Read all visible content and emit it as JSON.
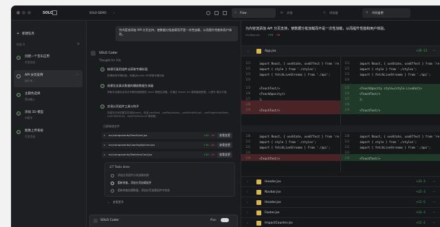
{
  "titlebar": {
    "brand": "SOLO",
    "project": "SOLO-DEMO",
    "tabs": [
      "Flow",
      "文档",
      "浏览器",
      "代码变更"
    ]
  },
  "sidebar": {
    "new_task": "新建任务",
    "section": "任务 3",
    "items": [
      {
        "title": "创建一个音乐应用",
        "sub": "开发完成"
      },
      {
        "title": "API 分页支持",
        "sub": "进行中..."
      },
      {
        "title": "主题色选择",
        "sub": "等待输入"
      },
      {
        "title": "添加 3D 模型",
        "sub": "中断中"
      },
      {
        "title": "图像上传系统",
        "sub": "开发完成"
      }
    ]
  },
  "chat": {
    "user_msg": "为内容流添加 API 分页支持，使数据分批加载而不是一次性加载，从而提升性能和用户体验。",
    "agent_name": "SOLO Coder",
    "thought": "Thought for 10s",
    "steps": [
      {
        "title": "梳理可复用组件以获取专辑封面",
        "desc": "梳理使用专辑封面，而通过fpulify API获取专辑封面"
      },
      {
        "title": "创建包含真实数据的播放数据生成器",
        "desc": "获取并创建包含真实专辑封面数据的 mock 数据生成器，并通过 Album art 更新播放数据，以提升 展示方案。"
      },
      {
        "title": "实现分页组件工具与钩子",
        "desc": "完成在已有的源文件添加mock，包括 useFeed，usePagination，useInfiniteScroll，useFragmentsState、useInfiniteList、useInfiniteCount 等函数。"
      }
    ],
    "files_header": "已经修改文件",
    "files": [
      {
        "name": "src/components/FeedCard.jsx",
        "add": "+20",
        "del": "-10",
        "btn": "查看变更"
      },
      {
        "name": "src/components/LoadingSpinner.jsx",
        "add": "+10",
        "del": "-20",
        "btn": "查看变更"
      },
      {
        "name": "src/components/SkeletonCard.jsx",
        "add": "+20",
        "del": "-10",
        "btn": "查看变更"
      }
    ],
    "todos_header": "1/7  Tasks done",
    "todos": [
      "添加分页组件分块加载机制",
      "重新修复，添加分页加载组件",
      "重新修复加载数据，添加分页加载组件中状态"
    ],
    "more": "查看更多",
    "bottom_agent": "SOLO Coder",
    "plan_label": "Plan"
  },
  "right": {
    "request": "为内容流添加 API 分页支持，使数据分批加载而不是一次性加载，从而提升性能和用户体验。",
    "subline": "src/App.jsx",
    "stats": "+12  -3",
    "stats_add": "+56",
    "stats_del": "-58",
    "file": "App.jsx",
    "file_stats": "+29 -13",
    "left_lines": [
      "121",
      "122",
      "123",
      "124",
      "125",
      "126",
      "127",
      "128",
      "129",
      "130",
      "131",
      "132",
      "133",
      "134"
    ],
    "code": [
      "import React, { useState, useEffect } from 'react';",
      "import { style } from './styles';",
      "import { fetchLiveStreams } from './api';",
      "",
      "<TeachText/>",
      "<TeachOpacity/>",
      "};",
      "",
      "<TeachText/>",
      "import React, { useState, useEffect } from 'react';",
      "import { style } from './styles';",
      "import { fetchLiveStreams } from './api';",
      "",
      "<TeachText/>"
    ],
    "code_right": [
      "import React, { useState, useEffect } from 'react';",
      "import { style } from './styles';",
      "import { fetchLiveStreams } from './api';",
      "",
      "<TeachOpacity style={style.LiveOut}>",
      "<TeachText/>",
      "};",
      "",
      "<TeachText/>",
      "import React, { useState, useEffect } from 'react';",
      "import { style } from './styles';",
      "import { fetchLiveStreams } from './api';",
      "",
      "<TeachText/>"
    ],
    "files": [
      {
        "name": "Header.jsx",
        "stats": "+23 -3"
      },
      {
        "name": "Navbar.jsx",
        "stats": "+22 -3"
      },
      {
        "name": "Header.jsx",
        "stats": "+12 -5"
      },
      {
        "name": "Footer.jsx",
        "stats": "+23 -3"
      },
      {
        "name": "ImpactCounter.jsx",
        "stats": "+12 -2"
      }
    ]
  },
  "colors": {
    "accent": "#2e7d50",
    "add": "#3fb950",
    "del": "#e5534b",
    "bg": "#1c1d20"
  }
}
